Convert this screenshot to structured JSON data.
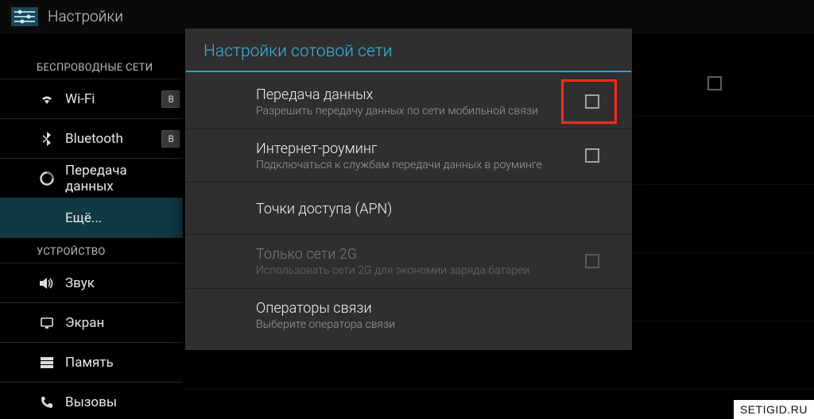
{
  "header": {
    "title": "Настройки"
  },
  "sidebar": {
    "sections": [
      {
        "label": "БЕСПРОВОДНЫЕ СЕТИ"
      },
      {
        "label": "УСТРОЙСТВО"
      }
    ],
    "wireless": [
      {
        "label": "Wi-Fi",
        "icon": "wifi",
        "badge": "В"
      },
      {
        "label": "Bluetooth",
        "icon": "bluetooth",
        "badge": "В"
      },
      {
        "label": "Передача данных",
        "icon": "data"
      },
      {
        "label": "Ещё...",
        "icon": "",
        "selected": true
      }
    ],
    "device": [
      {
        "label": "Звук",
        "icon": "volume"
      },
      {
        "label": "Экран",
        "icon": "display"
      },
      {
        "label": "Память",
        "icon": "storage"
      },
      {
        "label": "Вызовы",
        "icon": "phone"
      }
    ]
  },
  "dialog": {
    "title": "Настройки сотовой сети",
    "rows": [
      {
        "primary": "Передача данных",
        "secondary": "Разрешить передачу данных по сети мобильной связи",
        "checkbox": true,
        "highlighted": true
      },
      {
        "primary": "Интернет-роуминг",
        "secondary": "Подключаться к службам передачи данных в роуминге",
        "checkbox": true
      },
      {
        "primary": "Точки доступа (APN)",
        "secondary": ""
      },
      {
        "primary": "Только сети 2G",
        "secondary": "Использовать сети 2G для экономии заряда батареи",
        "checkbox": true,
        "disabled": true
      },
      {
        "primary": "Операторы связи",
        "secondary": "Выберите оператора связи"
      }
    ]
  },
  "watermark": "SETIGID.RU"
}
